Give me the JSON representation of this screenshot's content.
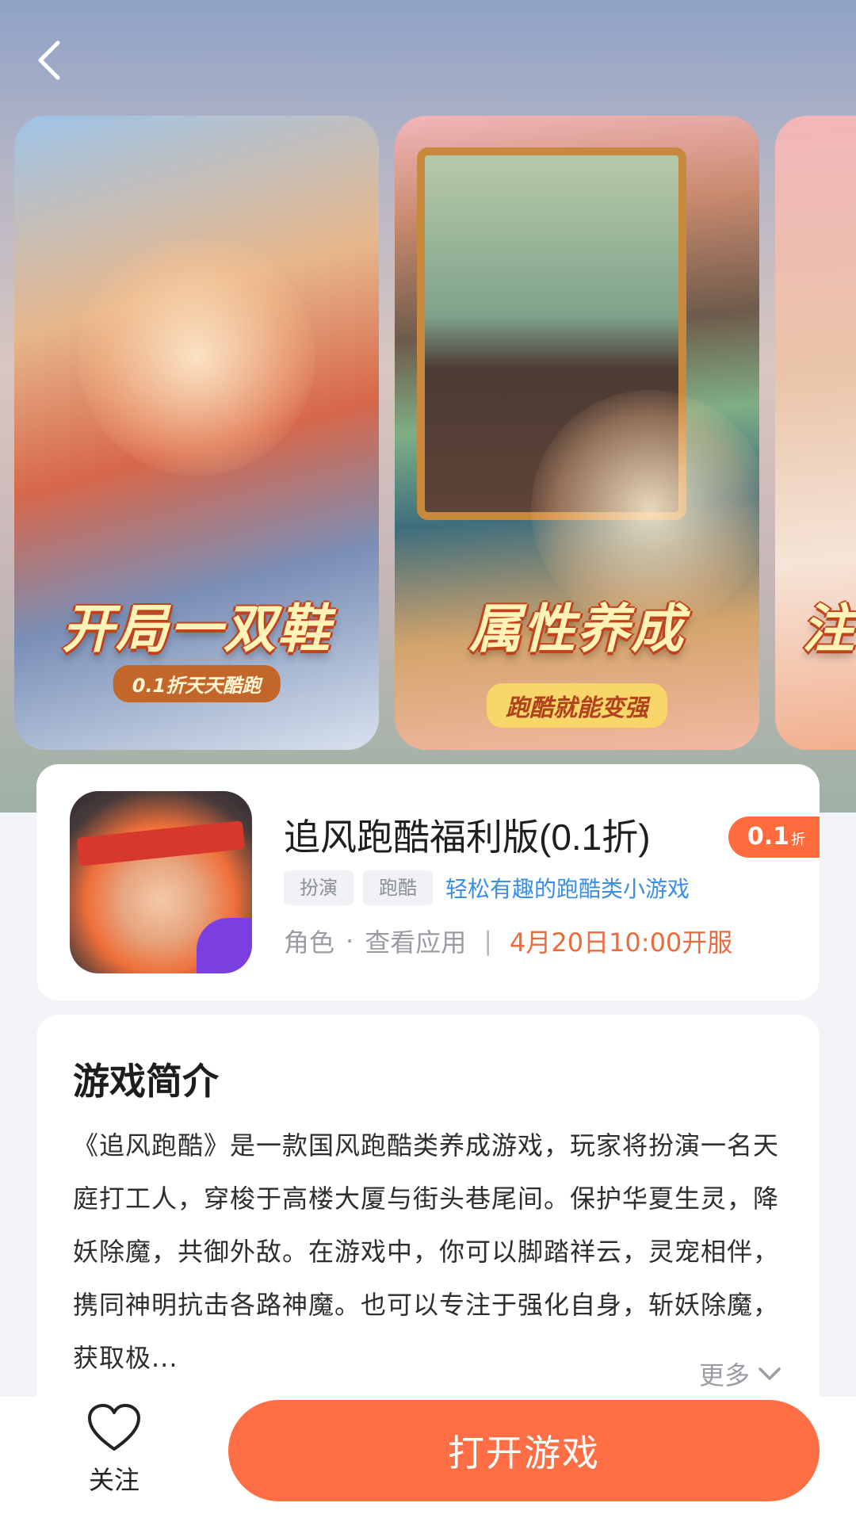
{
  "nav": {
    "back_icon": "chevron-left-icon"
  },
  "screenshots": [
    {
      "caption": "开局一双鞋",
      "subcaption": "0.1折天天酷跑"
    },
    {
      "caption": "属性养成",
      "subcaption": "跑酷就能变强"
    },
    {
      "caption": "注"
    }
  ],
  "app": {
    "title": "追风跑酷福利版(0.1折)",
    "discount": {
      "value": "0.1",
      "unit": "折"
    },
    "tags": [
      "扮演",
      "跑酷"
    ],
    "tagline": "轻松有趣的跑酷类小游戏",
    "category": "角色",
    "view_app": "查看应用",
    "server_time": "4月20日10:00开服"
  },
  "intro": {
    "heading": "游戏简介",
    "text": "《追风跑酷》是一款国风跑酷类养成游戏，玩家将扮演一名天庭打工人，穿梭于高楼大厦与街头巷尾间。保护华夏生灵，降妖除魔，共御外敌。在游戏中，你可以脚踏祥云，灵宠相伴，携同神明抗击各路神魔。也可以专注于强化自身，斩妖除魔，获取极...",
    "more_label": "更多"
  },
  "bottom": {
    "follow_label": "关注",
    "open_label": "打开游戏"
  },
  "colors": {
    "accent": "#ff6e44",
    "link": "#3a8ee6",
    "server": "#ec6b3d"
  }
}
